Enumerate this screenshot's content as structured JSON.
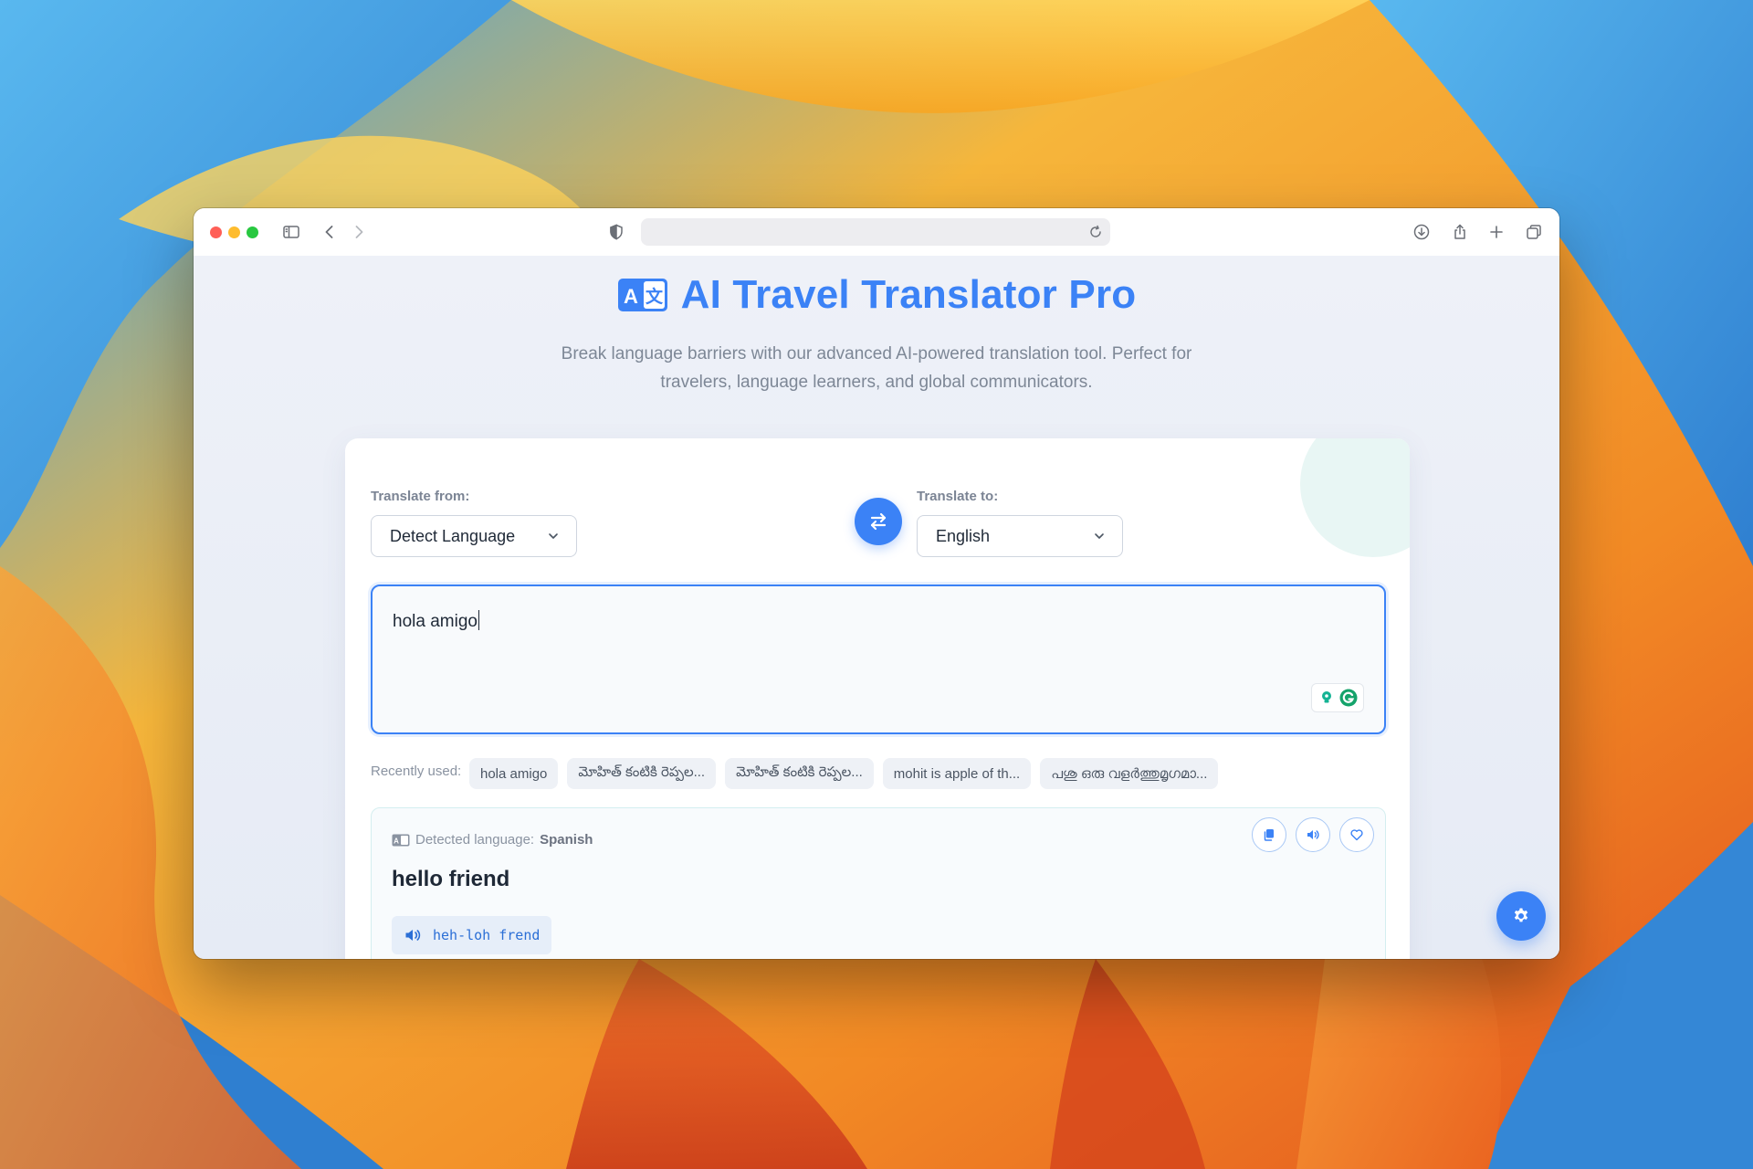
{
  "colors": {
    "accent": "#3b82f6",
    "page_background": "#edf1f7",
    "card_background": "#ffffff"
  },
  "browser": {
    "address_value": "",
    "icons": [
      "sidebar-icon",
      "back-icon",
      "forward-icon",
      "shield-icon",
      "reload-icon",
      "download-icon",
      "share-icon",
      "new-tab-icon",
      "tabs-overview-icon"
    ]
  },
  "header": {
    "title": "AI Travel Translator Pro",
    "title_icon": "translate-icon",
    "subtitle_line1": "Break language barriers with our advanced AI-powered translation tool. Perfect for",
    "subtitle_line2": "travelers, language learners, and global communicators."
  },
  "translator": {
    "from_label": "Translate from:",
    "from_value": "Detect Language",
    "to_label": "Translate to:",
    "to_value": "English",
    "swap_icon": "swap-icon",
    "input_text": "hola amigo"
  },
  "recent": {
    "label": "Recently used:",
    "items": [
      "hola amigo",
      "మోహిత్ కంటికి రెప్పల...",
      "మోహిత్ కంటికి రెప్పల...",
      "mohit is apple of th...",
      "പശു ഒരു വളർത്തുമൃഗമാ..."
    ]
  },
  "result": {
    "detected_prefix": "Detected language:",
    "detected_language": "Spanish",
    "translation": "hello friend",
    "pronunciation": "heh-loh frend",
    "actions": [
      "copy-icon",
      "speaker-icon",
      "heart-icon"
    ]
  },
  "fab": {
    "icon": "gear-icon"
  }
}
